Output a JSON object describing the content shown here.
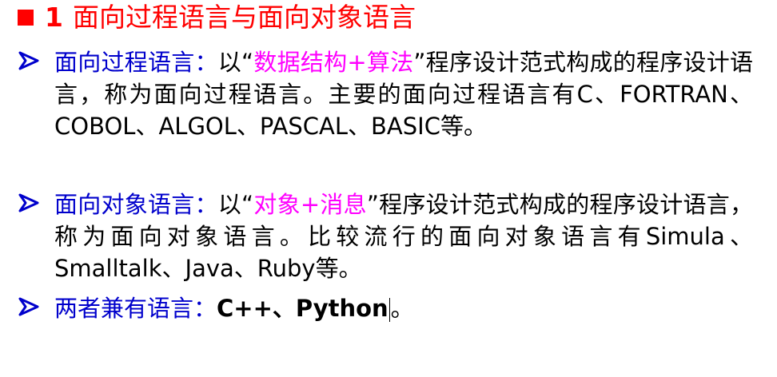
{
  "title": {
    "number": "1",
    "text": "面向过程语言与面向对象语言"
  },
  "bullets": [
    {
      "term": "面向过程语言：",
      "pre": "以“",
      "highlight": "数据结构+算法",
      "post": "”程序设计范式构成的程序设计语言，称为面向过程语言。主要的面向过程语言有C、FORTRAN、COBOL、ALGOL、PASCAL、BASIC等。"
    },
    {
      "term": "面向对象语言：",
      "pre": "以“",
      "highlight": "对象+消息",
      "post": "”程序设计范式构成的程序设计语言，称为面向对象语言。比较流行的面向对象语言有Simula、Smalltalk、Java、Ruby等。"
    },
    {
      "term": "两者兼有语言：",
      "pre": "C++、Python",
      "highlight": "",
      "post": "。"
    }
  ],
  "colors": {
    "title": "#ff0000",
    "term": "#0000cc",
    "highlight": "#ff00ff",
    "arrow": "#0000cc"
  },
  "icons": {
    "title_marker": "red-square-icon",
    "bullet_marker": "arrow-bullet-icon"
  }
}
